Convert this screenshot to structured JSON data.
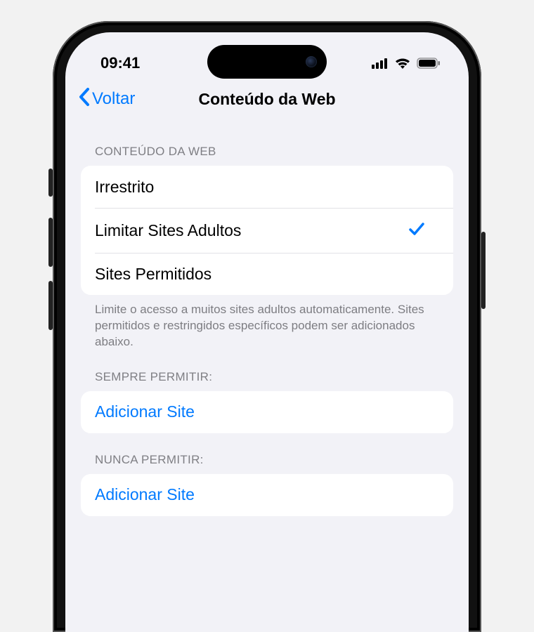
{
  "status_bar": {
    "time": "09:41"
  },
  "nav": {
    "back_label": "Voltar",
    "title": "Conteúdo da Web"
  },
  "sections": {
    "web_content": {
      "header": "CONTEÚDO DA WEB",
      "options": [
        {
          "label": "Irrestrito",
          "checked": false
        },
        {
          "label": "Limitar Sites Adultos",
          "checked": true
        },
        {
          "label": "Sites Permitidos",
          "checked": false
        }
      ],
      "footer": "Limite o acesso a muitos sites adultos automaticamente. Sites permitidos e restringidos específicos podem ser adicionados abaixo."
    },
    "always_allow": {
      "header": "SEMPRE PERMITIR:",
      "add_label": "Adicionar Site"
    },
    "never_allow": {
      "header": "NUNCA PERMITIR:",
      "add_label": "Adicionar Site"
    }
  }
}
